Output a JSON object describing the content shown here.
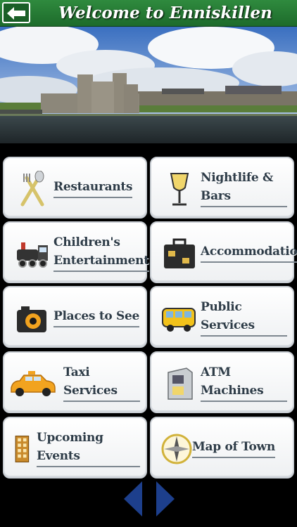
{
  "header": {
    "title": "Welcome to Enniskillen",
    "back_icon": "back-arrow-icon",
    "color": "#237a33"
  },
  "hero": {
    "description_icon": "castle-photo"
  },
  "menu": {
    "items": [
      {
        "label": "Restaurants",
        "icon": "fork-knife-icon"
      },
      {
        "label": "Nightlife & Bars",
        "icon": "wine-glass-icon"
      },
      {
        "label": "Children's\nEntertainment",
        "icon": "train-icon"
      },
      {
        "label": "Accommodation",
        "icon": "suitcase-icon"
      },
      {
        "label": "Places to See",
        "icon": "camera-icon"
      },
      {
        "label": "Public Services",
        "icon": "bus-icon"
      },
      {
        "label": "Taxi Services",
        "icon": "taxi-icon"
      },
      {
        "label": "ATM Machines",
        "icon": "atm-icon"
      },
      {
        "label": "Upcoming Events",
        "icon": "building-icon"
      },
      {
        "label": "Map of Town",
        "icon": "compass-icon"
      }
    ]
  },
  "nav": {
    "prev_icon": "prev-arrow-icon",
    "next_icon": "next-arrow-icon",
    "color": "#1d3f8c"
  }
}
